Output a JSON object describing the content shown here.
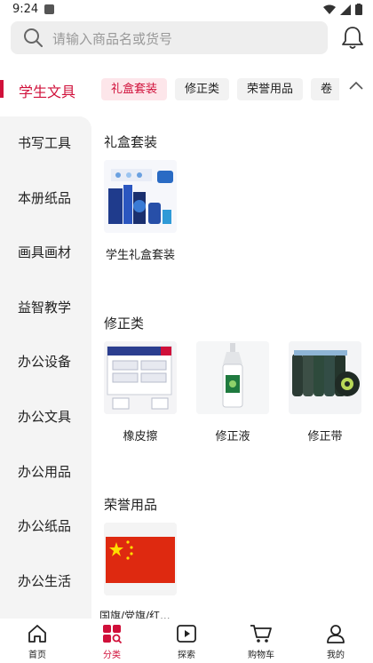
{
  "status": {
    "time": "9:24"
  },
  "search": {
    "placeholder": "请输入商品名或货号"
  },
  "main_category": "学生文具",
  "chips": [
    "礼盒套装",
    "修正类",
    "荣誉用品",
    "卷"
  ],
  "sidebar": [
    "书写工具",
    "本册纸品",
    "画具画材",
    "益智教学",
    "办公设备",
    "办公文具",
    "办公用品",
    "办公纸品",
    "办公生活"
  ],
  "sections": [
    {
      "title": "礼盒套装",
      "products": [
        "学生礼盒套装"
      ]
    },
    {
      "title": "修正类",
      "products": [
        "橡皮擦",
        "修正液",
        "修正带"
      ]
    },
    {
      "title": "荣誉用品",
      "products": [
        "国旗/党旗/红..."
      ]
    }
  ],
  "tabs": [
    "首页",
    "分类",
    "探索",
    "购物车",
    "我的"
  ],
  "colors": {
    "accent": "#d0103a",
    "chip_active_bg": "#fde6ea",
    "sidebar_bg": "#f4f4f4"
  }
}
